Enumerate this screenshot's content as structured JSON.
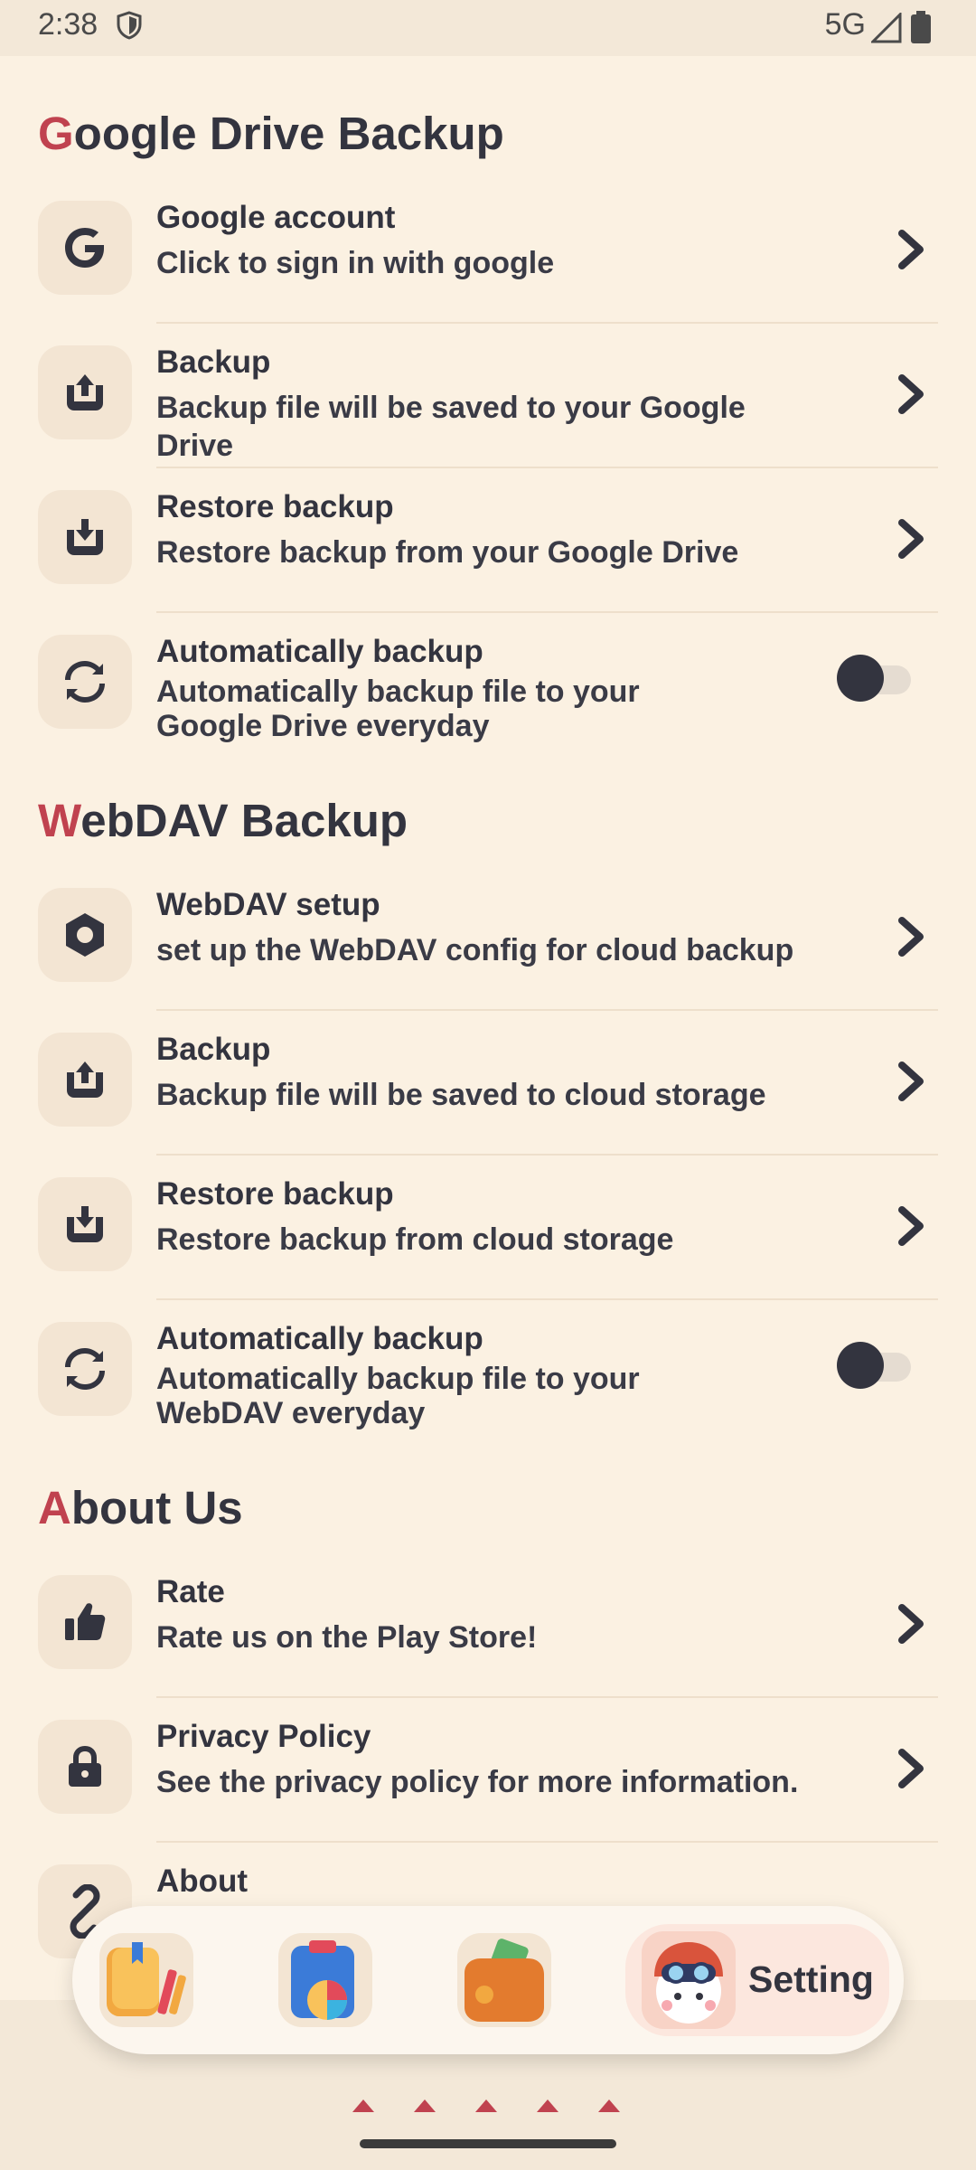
{
  "status_bar": {
    "time": "2:38",
    "network": "5G"
  },
  "sections": [
    {
      "initial": "G",
      "rest": "oogle Drive Backup"
    },
    {
      "initial": "W",
      "rest": "ebDAV Backup"
    },
    {
      "initial": "A",
      "rest": "bout Us"
    }
  ],
  "google": [
    {
      "title": "Google account",
      "subtitle": "Click to sign in with google"
    },
    {
      "title": "Backup",
      "subtitle": "Backup file will be saved to your Google Drive"
    },
    {
      "title": "Restore backup",
      "subtitle": "Restore backup from your Google Drive"
    },
    {
      "title": "Automatically backup",
      "subtitle": "Automatically backup file to your Google Drive everyday",
      "toggle_on": false
    }
  ],
  "webdav": [
    {
      "title": "WebDAV setup",
      "subtitle": "set up the WebDAV config for cloud backup"
    },
    {
      "title": "Backup",
      "subtitle": "Backup file will be saved to cloud storage"
    },
    {
      "title": "Restore backup",
      "subtitle": "Restore backup from cloud storage"
    },
    {
      "title": "Automatically backup",
      "subtitle": "Automatically backup file to your WebDAV everyday",
      "toggle_on": false
    }
  ],
  "about": [
    {
      "title": "Rate",
      "subtitle": "Rate us on the Play Store!"
    },
    {
      "title": "Privacy Policy",
      "subtitle": "See the privacy policy for more information."
    },
    {
      "title": "About",
      "subtitle": ""
    }
  ],
  "tabbar": {
    "active_label": "Setting"
  },
  "icons": {
    "google_account": "google-g-icon",
    "backup": "upload-tray-icon",
    "restore": "download-tray-icon",
    "auto": "sync-icon",
    "webdav_setup": "gear-hexagon-icon",
    "rate": "thumbs-up-icon",
    "privacy": "lock-icon",
    "about": "link-icon"
  },
  "colors": {
    "accent": "#C0424F",
    "background": "#FBF1E2",
    "text": "#33343F"
  }
}
